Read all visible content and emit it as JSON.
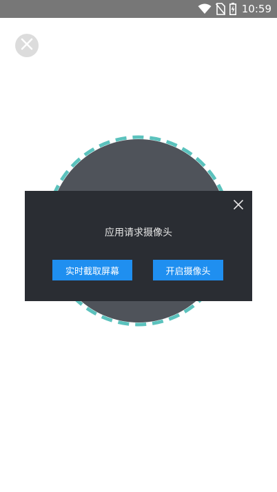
{
  "status_bar": {
    "time": "10:59",
    "icons": [
      "wifi-icon",
      "no-sim-icon",
      "battery-charging-icon"
    ]
  },
  "top_close": {
    "icon": "close-icon"
  },
  "preview": {
    "ring_color": "#5bc2bd",
    "fill_color": "#4f535a"
  },
  "dialog": {
    "title": "应用请求摄像头",
    "close_icon": "close-icon",
    "buttons": {
      "screenshot_label": "实时截取屏幕",
      "camera_label": "开启摄像头"
    },
    "accent_color": "#1f8ff0",
    "background_color": "#2a2d33"
  }
}
